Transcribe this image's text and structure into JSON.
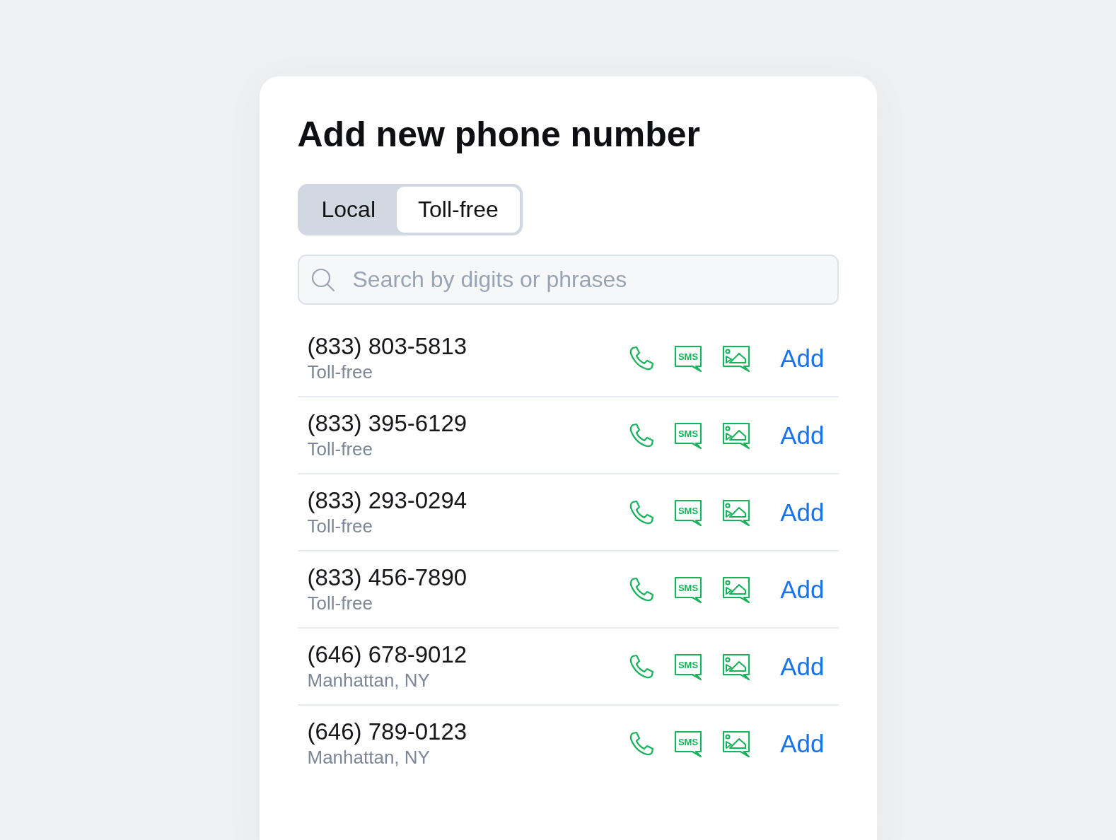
{
  "title": "Add new phone number",
  "tabs": [
    {
      "label": "Local",
      "selected": false
    },
    {
      "label": "Toll-free",
      "selected": true
    }
  ],
  "search": {
    "placeholder": "Search by digits or phrases"
  },
  "numbers": [
    {
      "number": "(833) 803-5813",
      "location": "Toll-free",
      "sms_badge": "SMS",
      "action": "Add"
    },
    {
      "number": "(833) 395-6129",
      "location": "Toll-free",
      "sms_badge": "SMS",
      "action": "Add"
    },
    {
      "number": "(833) 293-0294",
      "location": "Toll-free",
      "sms_badge": "SMS",
      "action": "Add"
    },
    {
      "number": "(833) 456-7890",
      "location": "Toll-free",
      "sms_badge": "SMS",
      "action": "Add"
    },
    {
      "number": "(646) 678-9012",
      "location": "Manhattan, NY",
      "sms_badge": "SMS",
      "action": "Add"
    },
    {
      "number": "(646) 789-0123",
      "location": "Manhattan, NY",
      "sms_badge": "SMS",
      "action": "Add"
    }
  ]
}
